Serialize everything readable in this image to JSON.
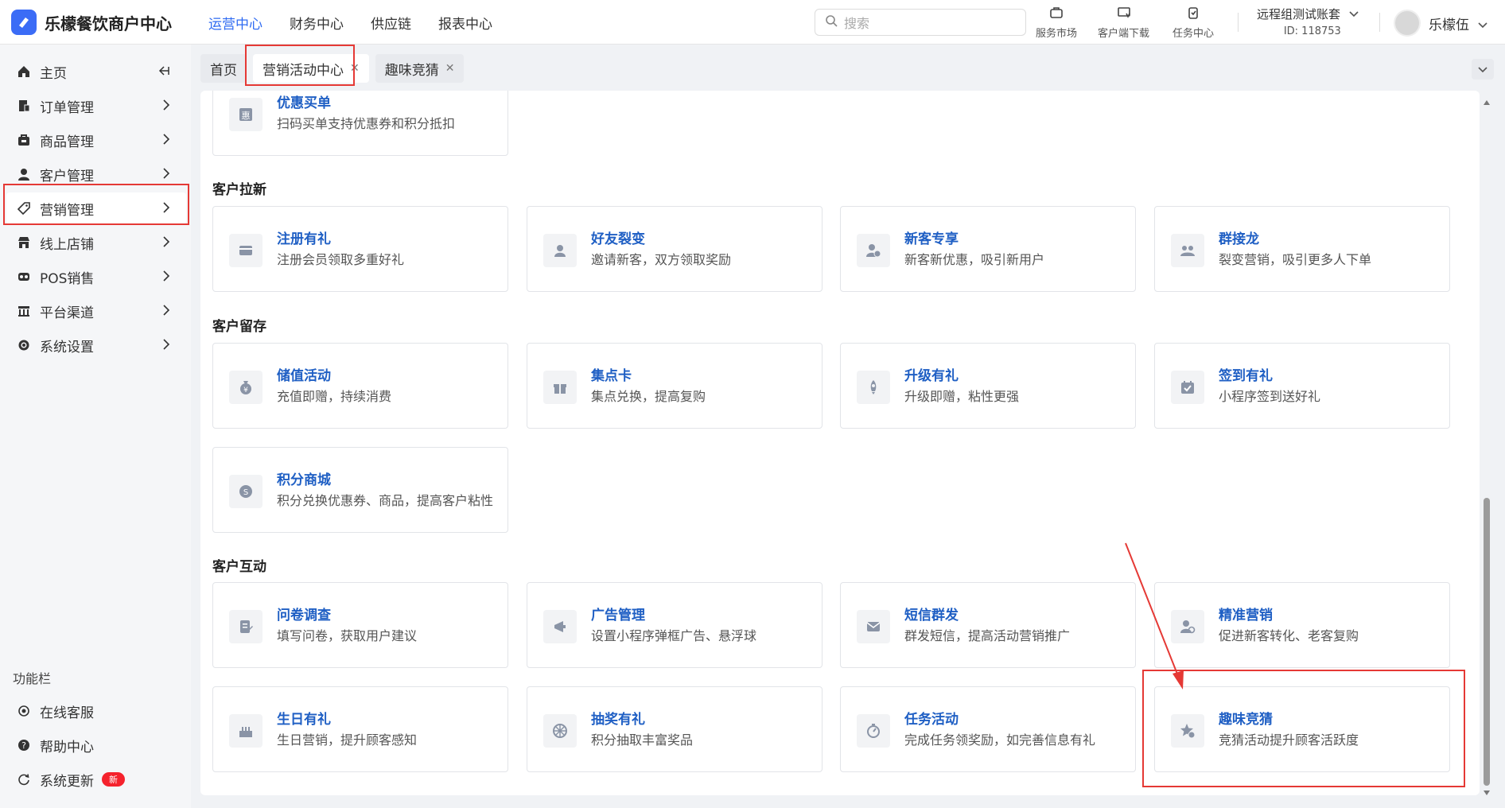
{
  "app": {
    "title": "乐檬餐饮商户中心"
  },
  "topnav": [
    "运营中心",
    "财务中心",
    "供应链",
    "报表中心"
  ],
  "search": {
    "placeholder": "搜索"
  },
  "tools": {
    "service_market": "服务市场",
    "client_download": "客户端下载",
    "task_center": "任务中心"
  },
  "account": {
    "name": "远程组测试账套",
    "id": "ID: 118753"
  },
  "user": {
    "name": "乐檬伍"
  },
  "sidebar": {
    "items": [
      {
        "label": "主页",
        "icon": "home-icon"
      },
      {
        "label": "订单管理",
        "icon": "order-icon"
      },
      {
        "label": "商品管理",
        "icon": "goods-icon"
      },
      {
        "label": "客户管理",
        "icon": "user-icon"
      },
      {
        "label": "营销管理",
        "icon": "tag-icon"
      },
      {
        "label": "线上店铺",
        "icon": "store-icon"
      },
      {
        "label": "POS销售",
        "icon": "pos-icon"
      },
      {
        "label": "平台渠道",
        "icon": "channel-icon"
      },
      {
        "label": "系统设置",
        "icon": "gear-icon"
      }
    ],
    "function_bar": "功能栏",
    "support": [
      {
        "label": "在线客服",
        "icon": "service-icon"
      },
      {
        "label": "帮助中心",
        "icon": "help-icon"
      },
      {
        "label": "系统更新",
        "icon": "refresh-icon",
        "badge": "新"
      }
    ]
  },
  "tabs": [
    {
      "label": "首页"
    },
    {
      "label": "营销活动中心",
      "closable": true
    },
    {
      "label": "趣味竞猜",
      "closable": true
    }
  ],
  "sections": [
    {
      "title": "客户拉新"
    },
    {
      "title": "客户留存"
    },
    {
      "title": "客户互动"
    }
  ],
  "cards": {
    "discount_buy": {
      "title": "优惠买单",
      "desc": "扫码买单支持优惠券和积分抵扣"
    },
    "register_gift": {
      "title": "注册有礼",
      "desc": "注册会员领取多重好礼"
    },
    "friend_fission": {
      "title": "好友裂变",
      "desc": "邀请新客，双方领取奖励"
    },
    "new_customer": {
      "title": "新客专享",
      "desc": "新客新优惠，吸引新用户"
    },
    "group_chain": {
      "title": "群接龙",
      "desc": "裂变营销，吸引更多人下单"
    },
    "stored_value": {
      "title": "储值活动",
      "desc": "充值即赠，持续消费"
    },
    "stamp_card": {
      "title": "集点卡",
      "desc": "集点兑换，提高复购"
    },
    "upgrade_gift": {
      "title": "升级有礼",
      "desc": "升级即赠，粘性更强"
    },
    "checkin_gift": {
      "title": "签到有礼",
      "desc": "小程序签到送好礼"
    },
    "points_mall": {
      "title": "积分商城",
      "desc": "积分兑换优惠券、商品，提高客户粘性"
    },
    "survey": {
      "title": "问卷调查",
      "desc": "填写问卷，获取用户建议"
    },
    "ad_manage": {
      "title": "广告管理",
      "desc": "设置小程序弹框广告、悬浮球"
    },
    "sms_broadcast": {
      "title": "短信群发",
      "desc": "群发短信，提高活动营销推广"
    },
    "precise_marketing": {
      "title": "精准营销",
      "desc": "促进新客转化、老客复购"
    },
    "birthday_gift": {
      "title": "生日有礼",
      "desc": "生日营销，提升顾客感知"
    },
    "lottery_gift": {
      "title": "抽奖有礼",
      "desc": "积分抽取丰富奖品"
    },
    "task_activity": {
      "title": "任务活动",
      "desc": "完成任务领奖励，如完善信息有礼"
    },
    "fun_quiz": {
      "title": "趣味竞猜",
      "desc": "竞猜活动提升顾客活跃度"
    }
  },
  "colors": {
    "accent": "#2f6bf2",
    "card_title": "#1f5fc4",
    "highlight": "#e53935"
  }
}
